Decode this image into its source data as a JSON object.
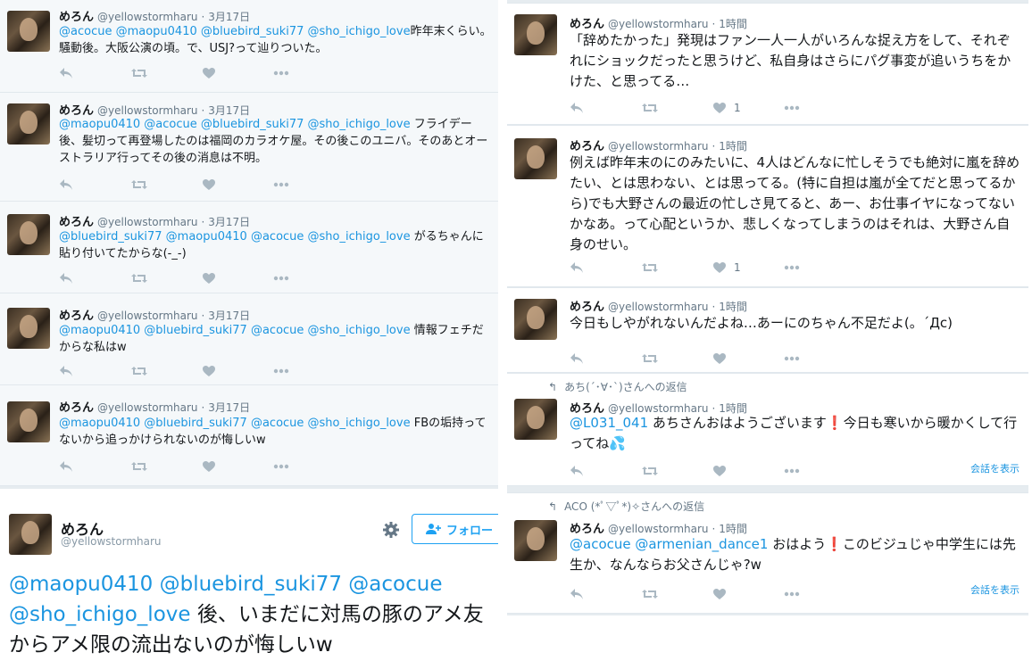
{
  "left_tweets": [
    {
      "name": "めろん",
      "handle": "@yellowstormharu",
      "time": "3月17日",
      "text_parts": [
        {
          "t": "@acocue @maopu0410 @bluebird_suki77 @sho_ichigo_love",
          "m": true
        },
        {
          "t": "昨年末くらい。騒動後。大阪公演の頃。で、USJ?って辿りついた。",
          "m": false
        }
      ]
    },
    {
      "name": "めろん",
      "handle": "@yellowstormharu",
      "time": "3月17日",
      "text_parts": [
        {
          "t": "@maopu0410 @acocue @bluebird_suki77 @sho_ichigo_love",
          "m": true
        },
        {
          "t": " フライデー後、髪切って再登場したのは福岡のカラオケ屋。その後このユニバ。そのあとオーストラリア行ってその後の消息は不明。",
          "m": false
        }
      ]
    },
    {
      "name": "めろん",
      "handle": "@yellowstormharu",
      "time": "3月17日",
      "text_parts": [
        {
          "t": "@bluebird_suki77 @maopu0410 @acocue @sho_ichigo_love",
          "m": true
        },
        {
          "t": " がるちゃんに貼り付いてたからな(-_-)",
          "m": false
        }
      ]
    },
    {
      "name": "めろん",
      "handle": "@yellowstormharu",
      "time": "3月17日",
      "text_parts": [
        {
          "t": "@maopu0410 @bluebird_suki77 @acocue @sho_ichigo_love",
          "m": true
        },
        {
          "t": " 情報フェチだからな私はw",
          "m": false
        }
      ]
    },
    {
      "name": "めろん",
      "handle": "@yellowstormharu",
      "time": "3月17日",
      "text_parts": [
        {
          "t": "@maopu0410 @bluebird_suki77 @acocue @sho_ichigo_love",
          "m": true
        },
        {
          "t": " FBの垢持ってないから追っかけられないのが悔しいw",
          "m": false
        }
      ]
    }
  ],
  "permalink": {
    "name": "めろん",
    "handle": "@yellowstormharu",
    "follow_label": "フォロー",
    "mentions": "@maopu0410 @bluebird_suki77 @acocue @sho_ichigo_love",
    "text": " 後、いまだに対馬の豚のアメ友からアメ限の流出ないのが悔しいw"
  },
  "right_tweets": [
    {
      "name": "めろん",
      "handle": "@yellowstormharu",
      "time": "1時間",
      "text": "「辞めたかった」発現はファン一人一人がいろんな捉え方をして、それぞれにショックだったと思うけど、私自身はさらにパグ事変が追いうちをかけた、と思ってる…",
      "likes": "1"
    },
    {
      "name": "めろん",
      "handle": "@yellowstormharu",
      "time": "1時間",
      "text": "例えば昨年末のにのみたいに、4人はどんなに忙しそうでも絶対に嵐を辞めたい、とは思わない、とは思ってる。(特に自担は嵐が全てだと思ってるから)でも大野さんの最近の忙しさ見てると、あー、お仕事イヤになってないかなあ。って心配というか、悲しくなってしまうのはそれは、大野さん自身のせい。",
      "likes": "1"
    },
    {
      "name": "めろん",
      "handle": "@yellowstormharu",
      "time": "1時間",
      "text": "今日もしやがれないんだよね…あーにのちゃん不足だよ(。´Дc)",
      "likes": ""
    },
    {
      "name": "めろん",
      "handle": "@yellowstormharu",
      "time": "1時間",
      "reply_to": "あち(´･∀･`)さんへの返信",
      "mentions": "@L031_041",
      "text": " あちさんおはようございます❗今日も寒いから暖かくして行ってね💦",
      "conversation": "会話を表示",
      "likes": ""
    },
    {
      "name": "めろん",
      "handle": "@yellowstormharu",
      "time": "1時間",
      "reply_to": "ACO (*ﾟ▽ﾟ*)✧さんへの返信",
      "mentions": "@acocue @armenian_dance1",
      "text": " おはよう❗このビジュじゃ中学生には先生か、なんならお父さんじゃ?w",
      "conversation": "会話を表示",
      "likes": ""
    }
  ],
  "icons": {
    "reply": "reply-icon",
    "retweet": "retweet-icon",
    "like": "heart-icon",
    "more": "more-icon",
    "gear": "gear-icon",
    "follow": "follow-user-icon"
  }
}
